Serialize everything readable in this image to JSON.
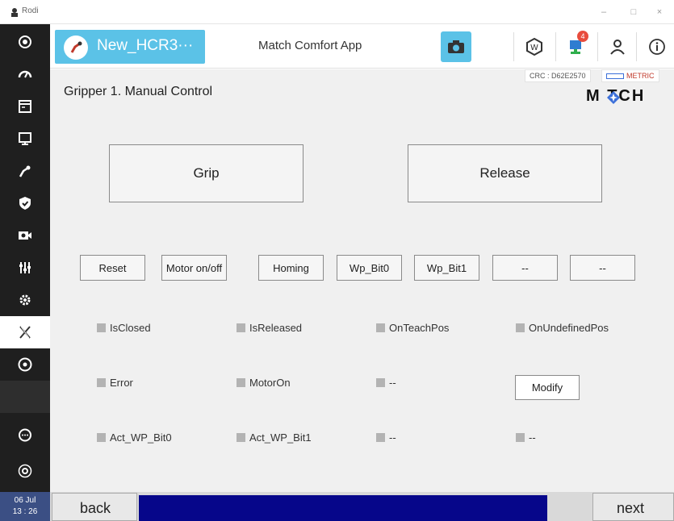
{
  "window": {
    "title": "Rodi",
    "controls": [
      "–",
      "□",
      "×"
    ]
  },
  "sidebar": {
    "items": [
      {
        "icon": "logo-icon"
      },
      {
        "icon": "speed-gauge-icon"
      },
      {
        "icon": "terminal-icon"
      },
      {
        "icon": "monitor-icon"
      },
      {
        "icon": "robot-arm-icon"
      },
      {
        "icon": "shield-icon"
      },
      {
        "icon": "camera-record-icon"
      },
      {
        "icon": "sliders-icon"
      },
      {
        "icon": "gear-icon"
      },
      {
        "icon": "x-logo-icon",
        "active": true
      },
      {
        "icon": "disc-icon"
      },
      {
        "icon": "blank"
      },
      {
        "icon": "chat-icon"
      },
      {
        "icon": "joystick-icon"
      }
    ],
    "date": "06 Jul",
    "time": "13 : 26"
  },
  "header": {
    "program_name": "New_HCR3···",
    "app_name": "Match Comfort App",
    "notification_count": "4"
  },
  "status_bar": {
    "crc": "CRC : D62E2570",
    "units": "METRIC",
    "brand": "M TCH"
  },
  "page": {
    "title": "Gripper 1. Manual Control"
  },
  "main_buttons": {
    "grip": "Grip",
    "release": "Release"
  },
  "small_buttons": [
    "Reset",
    "Motor on/off",
    "Homing",
    "Wp_Bit0",
    "Wp_Bit1",
    "--",
    "--"
  ],
  "status_rows": [
    [
      "IsClosed",
      "IsReleased",
      "OnTeachPos",
      "OnUndefinedPos"
    ],
    [
      "Error",
      "MotorOn",
      "--",
      ""
    ],
    [
      "Act_WP_Bit0",
      "Act_WP_Bit1",
      "--",
      "--"
    ]
  ],
  "modify_label": "Modify",
  "footer": {
    "back": "back",
    "next": "next"
  },
  "colors": {
    "accent": "#5bc2e7",
    "sidebar": "#1f1f1f",
    "progress": "#06068a",
    "led_off": "#b3b3b3",
    "badge": "#e84c3d"
  }
}
